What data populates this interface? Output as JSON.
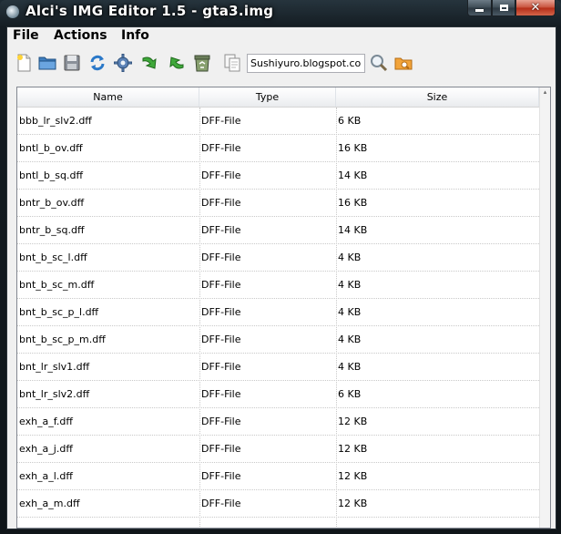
{
  "window": {
    "title": "Alci's IMG Editor 1.5 - gta3.img",
    "close_glyph": "✕"
  },
  "menu": {
    "items": [
      {
        "id": "file",
        "label": "File"
      },
      {
        "id": "actions",
        "label": "Actions"
      },
      {
        "id": "info",
        "label": "Info"
      }
    ]
  },
  "toolbar": {
    "buttons": [
      {
        "name": "new-document-icon"
      },
      {
        "name": "open-folder-icon"
      },
      {
        "name": "save-icon"
      },
      {
        "name": "refresh-icon"
      },
      {
        "name": "gear-icon"
      },
      {
        "name": "arrow-down-icon"
      },
      {
        "name": "arrow-up-icon"
      },
      {
        "name": "recycle-bin-icon"
      },
      {
        "name": "copy-icon"
      }
    ],
    "url_value": "Sushiyuro.blogspot.com",
    "search_icon": "search-icon",
    "folder_search_icon": "folder-search-icon"
  },
  "table": {
    "columns": [
      "Name",
      "Type",
      "Size"
    ],
    "rows": [
      {
        "name": "bbb_lr_slv2.dff",
        "type": "DFF-File",
        "size": "6 KB"
      },
      {
        "name": "bntl_b_ov.dff",
        "type": "DFF-File",
        "size": "16 KB"
      },
      {
        "name": "bntl_b_sq.dff",
        "type": "DFF-File",
        "size": "14 KB"
      },
      {
        "name": "bntr_b_ov.dff",
        "type": "DFF-File",
        "size": "16 KB"
      },
      {
        "name": "bntr_b_sq.dff",
        "type": "DFF-File",
        "size": "14 KB"
      },
      {
        "name": "bnt_b_sc_l.dff",
        "type": "DFF-File",
        "size": "4 KB"
      },
      {
        "name": "bnt_b_sc_m.dff",
        "type": "DFF-File",
        "size": "4 KB"
      },
      {
        "name": "bnt_b_sc_p_l.dff",
        "type": "DFF-File",
        "size": "4 KB"
      },
      {
        "name": "bnt_b_sc_p_m.dff",
        "type": "DFF-File",
        "size": "4 KB"
      },
      {
        "name": "bnt_lr_slv1.dff",
        "type": "DFF-File",
        "size": "4 KB"
      },
      {
        "name": "bnt_lr_slv2.dff",
        "type": "DFF-File",
        "size": "6 KB"
      },
      {
        "name": "exh_a_f.dff",
        "type": "DFF-File",
        "size": "12 KB"
      },
      {
        "name": "exh_a_j.dff",
        "type": "DFF-File",
        "size": "12 KB"
      },
      {
        "name": "exh_a_l.dff",
        "type": "DFF-File",
        "size": "12 KB"
      },
      {
        "name": "exh_a_m.dff",
        "type": "DFF-File",
        "size": "12 KB"
      }
    ]
  },
  "colors": {
    "title_text": "#ffffff",
    "close_button": "#c7503a",
    "client_background": "#f0f0f0",
    "table_border": "#828790"
  }
}
